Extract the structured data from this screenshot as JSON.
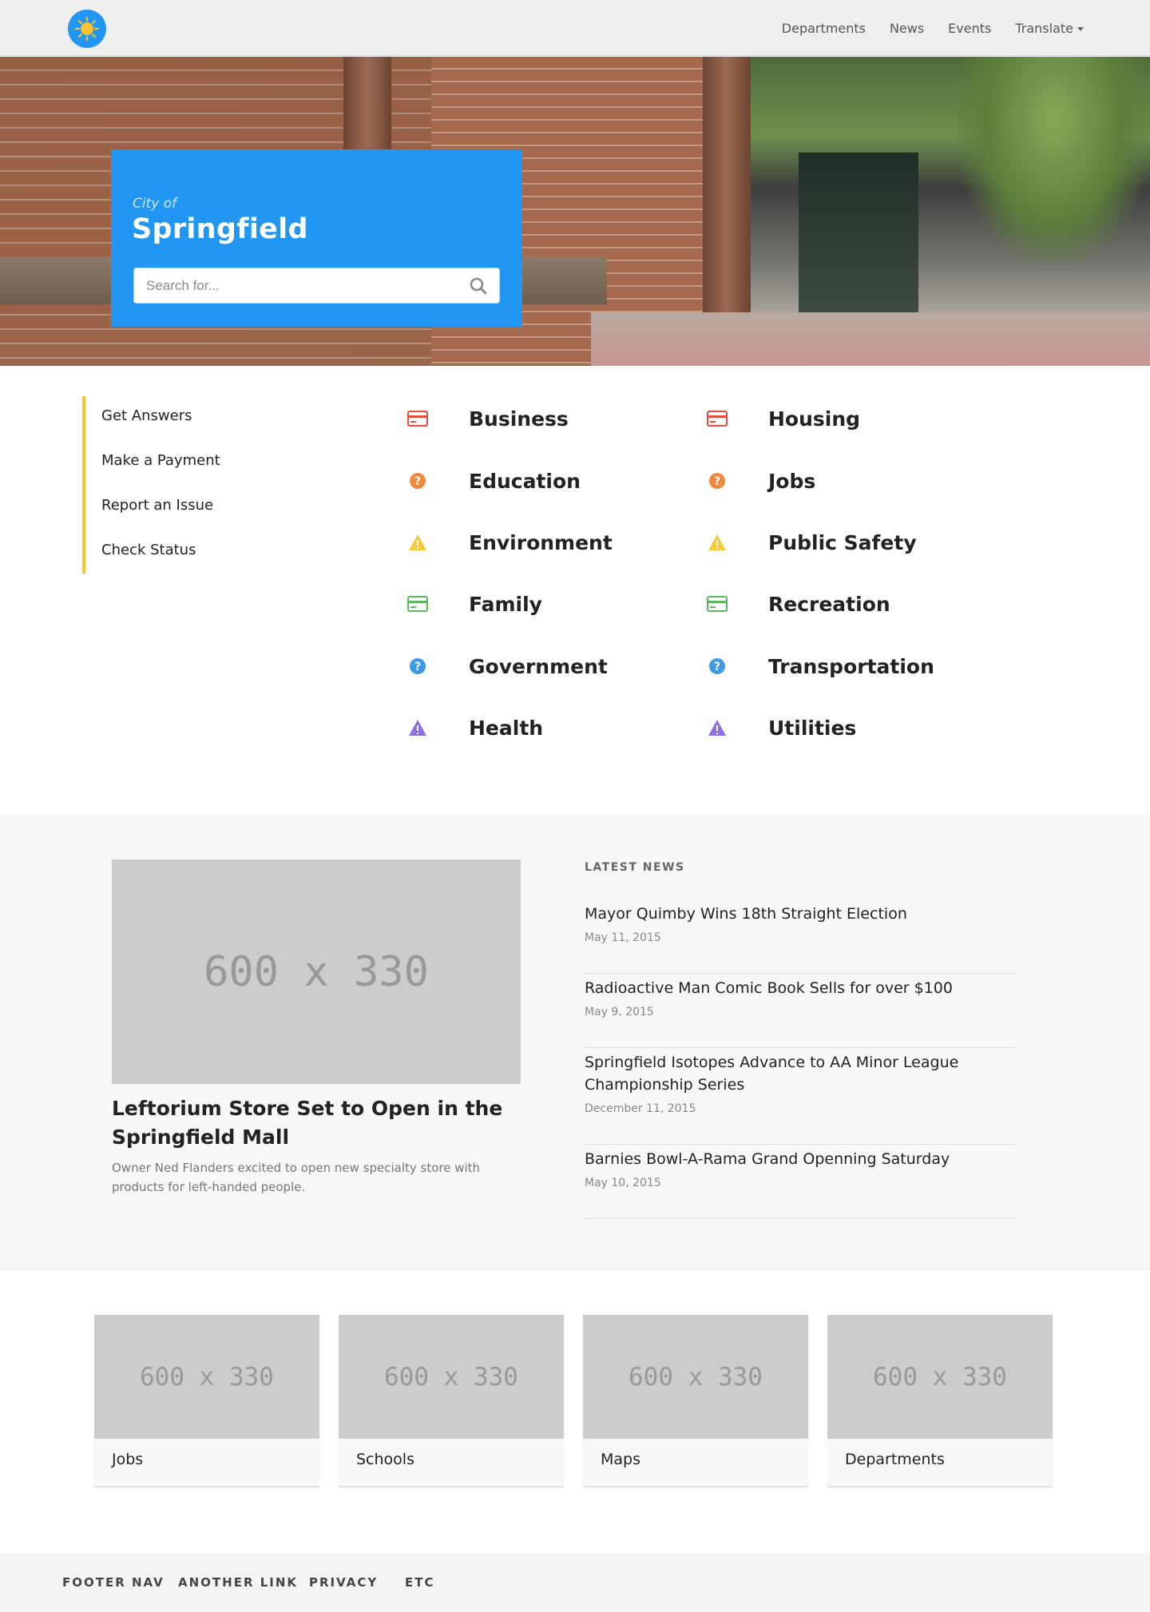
{
  "header": {
    "logo_icon": "sun-icon",
    "nav": [
      {
        "label": "Departments"
      },
      {
        "label": "News"
      },
      {
        "label": "Events"
      },
      {
        "label": "Translate"
      }
    ]
  },
  "hero": {
    "city_prefix": "City of",
    "city_name": "Springfield",
    "search_placeholder": "Search for...",
    "search_icon": "search-icon"
  },
  "quick_links": [
    "Get Answers",
    "Make a Payment",
    "Report an Issue",
    "Check Status"
  ],
  "categories": {
    "left": [
      {
        "label": "Business",
        "icon": "credit-card-icon",
        "color": "#e74c3c"
      },
      {
        "label": "Education",
        "icon": "question-circle-icon",
        "color": "#f0883e"
      },
      {
        "label": "Environment",
        "icon": "warning-triangle-icon",
        "color": "#f6cb3a"
      },
      {
        "label": "Family",
        "icon": "credit-card-icon",
        "color": "#5cb85c"
      },
      {
        "label": "Government",
        "icon": "question-circle-icon",
        "color": "#3d9be9"
      },
      {
        "label": "Health",
        "icon": "warning-triangle-icon",
        "color": "#8e6fe6"
      }
    ],
    "right": [
      {
        "label": "Housing",
        "icon": "credit-card-icon",
        "color": "#e74c3c"
      },
      {
        "label": "Jobs",
        "icon": "question-circle-icon",
        "color": "#f0883e"
      },
      {
        "label": "Public Safety",
        "icon": "warning-triangle-icon",
        "color": "#f6cb3a"
      },
      {
        "label": "Recreation",
        "icon": "credit-card-icon",
        "color": "#5cb85c"
      },
      {
        "label": "Transportation",
        "icon": "question-circle-icon",
        "color": "#3d9be9"
      },
      {
        "label": "Utilities",
        "icon": "warning-triangle-icon",
        "color": "#8e6fe6"
      }
    ]
  },
  "featured": {
    "image_text": "600 x 330",
    "title": "Leftorium Store Set to Open in the Springfield Mall",
    "description": "Owner Ned Flanders excited to open new specialty store with products for left-handed people."
  },
  "latest_news": {
    "heading": "LATEST NEWS",
    "items": [
      {
        "title": "Mayor Quimby Wins 18th Straight Election",
        "date": "May 11, 2015"
      },
      {
        "title": "Radioactive Man Comic Book Sells for over $100",
        "date": "May 9, 2015"
      },
      {
        "title": "Springfield Isotopes Advance to AA Minor League Championship Series",
        "date": "December 11, 2015"
      },
      {
        "title": "Barnies Bowl-A-Rama Grand Openning Saturday",
        "date": "May 10, 2015"
      }
    ]
  },
  "tiles": [
    {
      "image_text": "600 x 330",
      "label": "Jobs"
    },
    {
      "image_text": "600 x 330",
      "label": "Schools"
    },
    {
      "image_text": "600 x 330",
      "label": "Maps"
    },
    {
      "image_text": "600 x 330",
      "label": "Departments"
    }
  ],
  "footer": [
    "FOOTER NAV",
    "ANOTHER LINK",
    "PRIVACY",
    "ETC"
  ],
  "colors": {
    "accent_blue": "#2196f3",
    "accent_yellow": "#fbc02d"
  }
}
